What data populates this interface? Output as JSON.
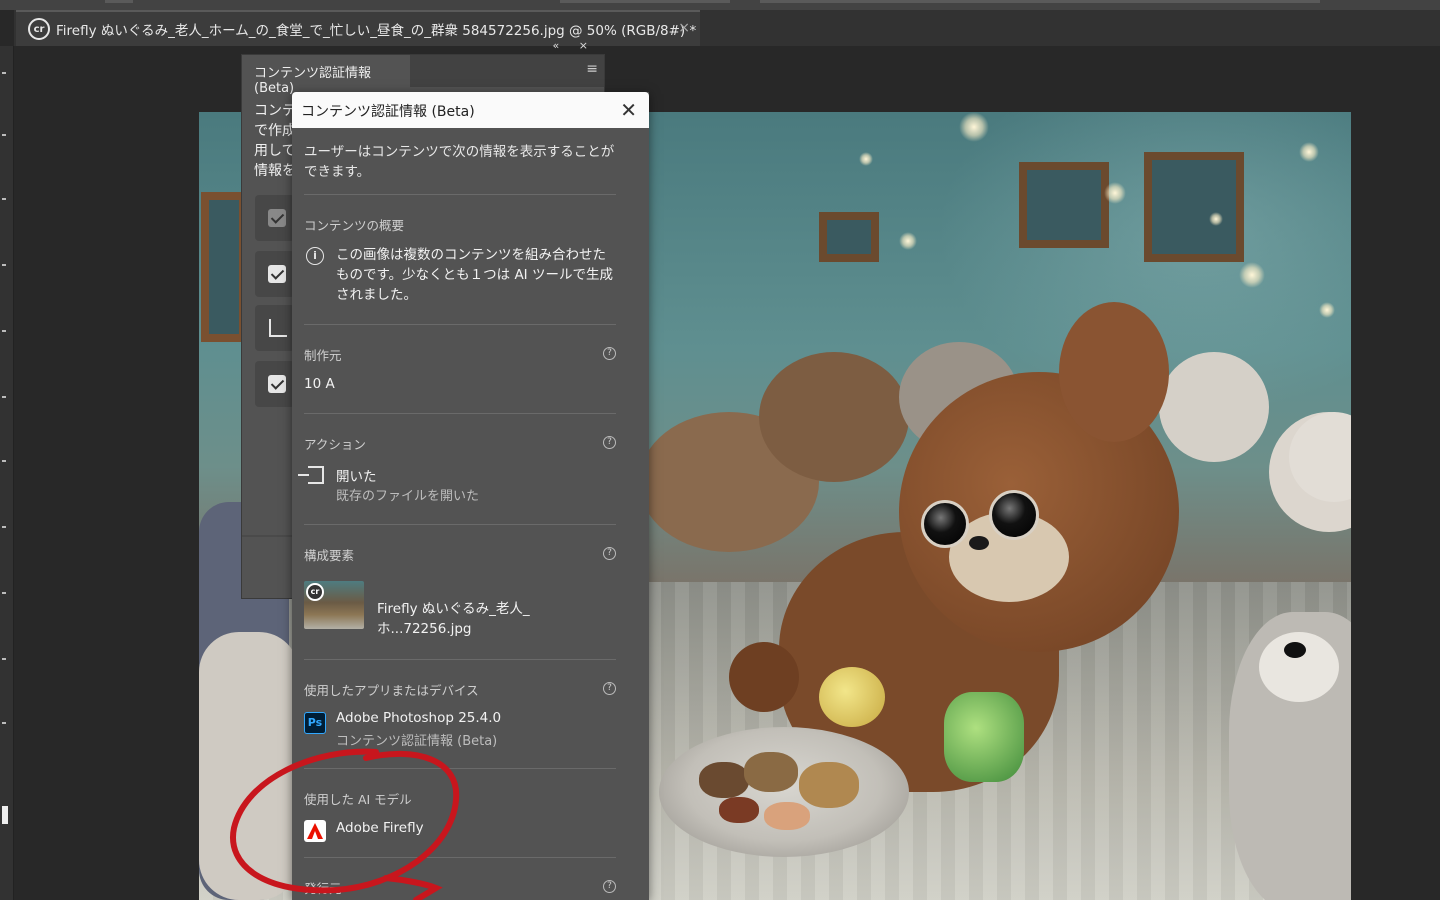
{
  "document_tab": {
    "badge": "cr",
    "title": "Firefly ぬいぐるみ_老人_ホーム_の_食堂_で_忙しい_昼食_の_群衆 584572256.jpg @ 50% (RGB/8#) *",
    "close": "×"
  },
  "back_panel": {
    "controls": "« ×",
    "tab_title": "コンテンツ認証情報 (Beta)",
    "menu_icon": "≡",
    "text_lines": [
      "コンテ",
      "で作成",
      "用して",
      "情報を"
    ]
  },
  "popover": {
    "title": "コンテンツ認証情報 (Beta)",
    "close": "✕",
    "intro": "ユーザーはコンテンツで次の情報を表示することができます。",
    "summary": {
      "label": "コンテンツの概要",
      "icon": "info-icon",
      "text": "この画像は複数のコンテンツを組み合わせたものです。少なくとも１つは AI ツールで生成されました。"
    },
    "producer": {
      "label": "制作元",
      "value": "10 A"
    },
    "actions": {
      "label": "アクション",
      "action_title": "開いた",
      "action_desc": "既存のファイルを開いた"
    },
    "ingredients": {
      "label": "構成要素",
      "thumb_badge": "cr",
      "file_name": "Firefly ぬいぐるみ_老人_ホ...72256.jpg"
    },
    "apps": {
      "label": "使用したアプリまたはデバイス",
      "icon_text": "Ps",
      "app_name": "Adobe Photoshop 25.4.0",
      "app_sub": "コンテンツ認証情報 (Beta)"
    },
    "ai_model": {
      "label": "使用した AI モデル",
      "model_name": "Adobe Firefly"
    },
    "issuer": {
      "label": "発行元"
    },
    "help_glyph": "?"
  },
  "colors": {
    "annotation_red": "#c8161d",
    "panel_bg": "#535353",
    "app_bg": "#282828"
  }
}
